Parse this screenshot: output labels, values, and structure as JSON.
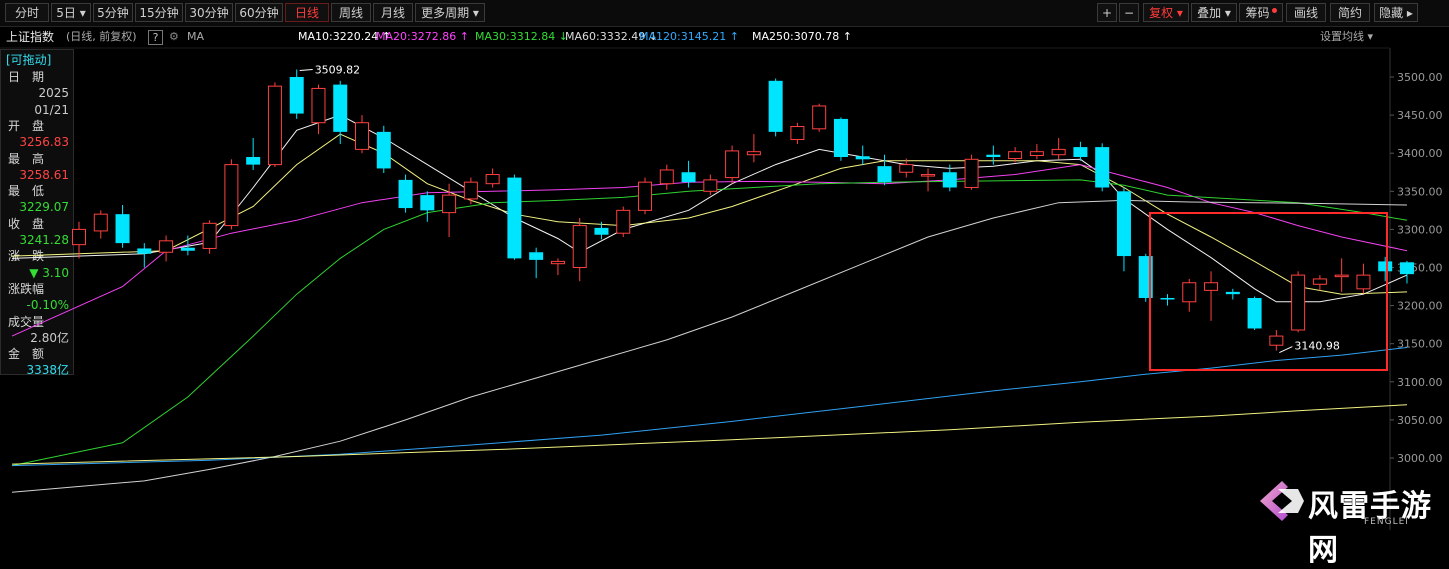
{
  "toolbar": {
    "periods": [
      {
        "label": "分时",
        "active": false
      },
      {
        "label": "5日 ▾",
        "active": false
      },
      {
        "label": "5分钟",
        "active": false
      },
      {
        "label": "15分钟",
        "active": false
      },
      {
        "label": "30分钟",
        "active": false
      },
      {
        "label": "60分钟",
        "active": false
      },
      {
        "label": "日线",
        "active": true
      },
      {
        "label": "周线",
        "active": false
      },
      {
        "label": "月线",
        "active": false
      },
      {
        "label": "更多周期 ▾",
        "active": false
      }
    ],
    "right_buttons": [
      "+",
      "−",
      "复权 ▾",
      "叠加 ▾",
      "筹码",
      "画线",
      "简约",
      "隐藏 ▸"
    ]
  },
  "header": {
    "index_name": "上证指数",
    "mode": "(日线, 前复权)",
    "help": "?",
    "ma_label": "MA",
    "ma_settings": "设置均线 ▾",
    "ma_items": [
      {
        "text": "MA10:3220.24 ↑",
        "color": "#ffffff"
      },
      {
        "text": "MA20:3272.86 ↑",
        "color": "#ff44ff"
      },
      {
        "text": "MA30:3312.84 ↓",
        "color": "#33dd33"
      },
      {
        "text": "MA60:3332.49 ↓",
        "color": "#dddddd"
      },
      {
        "text": "MA120:3145.21 ↑",
        "color": "#33aaff"
      },
      {
        "text": "MA250:3070.78 ↑",
        "color": "#ffffff"
      }
    ]
  },
  "info": {
    "drag": "[可拖动]",
    "rows": [
      {
        "label": "日　期",
        "value": "",
        "color": "#cccccc"
      },
      {
        "label": "",
        "value": "2025",
        "color": "#cccccc"
      },
      {
        "label": "",
        "value": "01/21",
        "color": "#cccccc"
      },
      {
        "label": "开　盘",
        "value": "",
        "color": "#cccccc"
      },
      {
        "label": "",
        "value": "3256.83",
        "color": "#ff4444"
      },
      {
        "label": "最　高",
        "value": "",
        "color": "#cccccc"
      },
      {
        "label": "",
        "value": "3258.61",
        "color": "#ff4444"
      },
      {
        "label": "最　低",
        "value": "",
        "color": "#cccccc"
      },
      {
        "label": "",
        "value": "3229.07",
        "color": "#33dd33"
      },
      {
        "label": "收　盘",
        "value": "",
        "color": "#cccccc"
      },
      {
        "label": "",
        "value": "3241.28",
        "color": "#33dd33"
      },
      {
        "label": "涨　跌",
        "value": "",
        "color": "#cccccc"
      },
      {
        "label": "",
        "value": "▼ 3.10",
        "color": "#33dd33"
      },
      {
        "label": "涨跌幅",
        "value": "",
        "color": "#cccccc"
      },
      {
        "label": "",
        "value": "-0.10%",
        "color": "#33dd33"
      },
      {
        "label": "成交量",
        "value": "",
        "color": "#cccccc"
      },
      {
        "label": "",
        "value": "2.80亿",
        "color": "#cccccc"
      },
      {
        "label": "金　额",
        "value": "",
        "color": "#cccccc"
      },
      {
        "label": "",
        "value": "3338亿",
        "color": "#33ddee"
      }
    ]
  },
  "logo": {
    "name": "风雷手游网",
    "sub": "FENGLEI"
  },
  "colors": {
    "up": "#ff4040",
    "down": "#00e5ff",
    "highlight": "#ff2a2a"
  },
  "chart_data": {
    "type": "candlestick",
    "ylim": [
      2980,
      3530
    ],
    "y_ticks": [
      3000.0,
      3050.0,
      3100.0,
      3150.0,
      3200.0,
      3250.0,
      3300.0,
      3350.0,
      3400.0,
      3450.0,
      3500.0
    ],
    "candles": [
      {
        "o": 3280,
        "c": 3300,
        "h": 3310,
        "l": 3262
      },
      {
        "o": 3298,
        "c": 3320,
        "h": 3325,
        "l": 3288
      },
      {
        "o": 3320,
        "c": 3282,
        "h": 3332,
        "l": 3276
      },
      {
        "o": 3275,
        "c": 3268,
        "h": 3282,
        "l": 3250
      },
      {
        "o": 3270,
        "c": 3285,
        "h": 3292,
        "l": 3258
      },
      {
        "o": 3276,
        "c": 3272,
        "h": 3292,
        "l": 3266
      },
      {
        "o": 3275,
        "c": 3308,
        "h": 3312,
        "l": 3268
      },
      {
        "o": 3305,
        "c": 3385,
        "h": 3392,
        "l": 3300
      },
      {
        "o": 3395,
        "c": 3385,
        "h": 3420,
        "l": 3378
      },
      {
        "o": 3385,
        "c": 3488,
        "h": 3493,
        "l": 3382
      },
      {
        "o": 3500,
        "c": 3452,
        "h": 3509.82,
        "l": 3445
      },
      {
        "o": 3440,
        "c": 3485,
        "h": 3490,
        "l": 3425
      },
      {
        "o": 3490,
        "c": 3428,
        "h": 3495,
        "l": 3412
      },
      {
        "o": 3405,
        "c": 3440,
        "h": 3450,
        "l": 3400
      },
      {
        "o": 3428,
        "c": 3380,
        "h": 3436,
        "l": 3374
      },
      {
        "o": 3365,
        "c": 3328,
        "h": 3372,
        "l": 3322
      },
      {
        "o": 3345,
        "c": 3325,
        "h": 3350,
        "l": 3310
      },
      {
        "o": 3322,
        "c": 3345,
        "h": 3360,
        "l": 3290
      },
      {
        "o": 3340,
        "c": 3362,
        "h": 3368,
        "l": 3333
      },
      {
        "o": 3360,
        "c": 3372,
        "h": 3380,
        "l": 3355
      },
      {
        "o": 3368,
        "c": 3262,
        "h": 3372,
        "l": 3260
      },
      {
        "o": 3270,
        "c": 3260,
        "h": 3276,
        "l": 3236
      },
      {
        "o": 3255,
        "c": 3258,
        "h": 3262,
        "l": 3240
      },
      {
        "o": 3250,
        "c": 3305,
        "h": 3315,
        "l": 3232
      },
      {
        "o": 3302,
        "c": 3293,
        "h": 3310,
        "l": 3287
      },
      {
        "o": 3295,
        "c": 3325,
        "h": 3330,
        "l": 3290
      },
      {
        "o": 3325,
        "c": 3362,
        "h": 3368,
        "l": 3320
      },
      {
        "o": 3360,
        "c": 3378,
        "h": 3385,
        "l": 3352
      },
      {
        "o": 3375,
        "c": 3362,
        "h": 3390,
        "l": 3355
      },
      {
        "o": 3350,
        "c": 3365,
        "h": 3372,
        "l": 3345
      },
      {
        "o": 3368,
        "c": 3403,
        "h": 3410,
        "l": 3360
      },
      {
        "o": 3398,
        "c": 3402,
        "h": 3425,
        "l": 3388
      },
      {
        "o": 3495,
        "c": 3428,
        "h": 3498,
        "l": 3422
      },
      {
        "o": 3418,
        "c": 3435,
        "h": 3440,
        "l": 3412
      },
      {
        "o": 3432,
        "c": 3462,
        "h": 3465,
        "l": 3428
      },
      {
        "o": 3445,
        "c": 3395,
        "h": 3447,
        "l": 3390
      },
      {
        "o": 3396,
        "c": 3392,
        "h": 3410,
        "l": 3385
      },
      {
        "o": 3383,
        "c": 3362,
        "h": 3398,
        "l": 3358
      },
      {
        "o": 3375,
        "c": 3385,
        "h": 3393,
        "l": 3368
      },
      {
        "o": 3370,
        "c": 3372,
        "h": 3380,
        "l": 3350
      },
      {
        "o": 3375,
        "c": 3355,
        "h": 3385,
        "l": 3350
      },
      {
        "o": 3355,
        "c": 3392,
        "h": 3398,
        "l": 3352
      },
      {
        "o": 3398,
        "c": 3395,
        "h": 3410,
        "l": 3385
      },
      {
        "o": 3393,
        "c": 3402,
        "h": 3408,
        "l": 3388
      },
      {
        "o": 3397,
        "c": 3402,
        "h": 3412,
        "l": 3392
      },
      {
        "o": 3398,
        "c": 3405,
        "h": 3420,
        "l": 3392
      },
      {
        "o": 3408,
        "c": 3395,
        "h": 3415,
        "l": 3390
      },
      {
        "o": 3408,
        "c": 3355,
        "h": 3413,
        "l": 3350
      },
      {
        "o": 3350,
        "c": 3265,
        "h": 3355,
        "l": 3245
      },
      {
        "o": 3265,
        "c": 3210,
        "h": 3268,
        "l": 3205
      },
      {
        "o": 3210,
        "c": 3208,
        "h": 3215,
        "l": 3200
      },
      {
        "o": 3205,
        "c": 3230,
        "h": 3235,
        "l": 3192
      },
      {
        "o": 3220,
        "c": 3230,
        "h": 3245,
        "l": 3180
      },
      {
        "o": 3218,
        "c": 3215,
        "h": 3222,
        "l": 3208
      },
      {
        "o": 3210,
        "c": 3170,
        "h": 3212,
        "l": 3168
      },
      {
        "o": 3148,
        "c": 3160,
        "h": 3168,
        "l": 3140.98
      },
      {
        "o": 3168,
        "c": 3240,
        "h": 3245,
        "l": 3165
      },
      {
        "o": 3228,
        "c": 3235,
        "h": 3240,
        "l": 3220
      },
      {
        "o": 3238,
        "c": 3240,
        "h": 3262,
        "l": 3218
      },
      {
        "o": 3222,
        "c": 3240,
        "h": 3255,
        "l": 3216
      },
      {
        "o": 3258,
        "c": 3245,
        "h": 3264,
        "l": 3232
      },
      {
        "o": 3256.83,
        "c": 3241.28,
        "h": 3258.61,
        "l": 3229.07
      }
    ],
    "annotations": [
      {
        "text": "3509.82",
        "index": 10,
        "value": 3509.82
      },
      {
        "text": "3140.98",
        "index": 55,
        "value": 3140.98
      }
    ],
    "series": [
      {
        "name": "MA10",
        "color": "#ffffff",
        "points": [
          [
            0,
            3262
          ],
          [
            3,
            3268
          ],
          [
            6,
            3283
          ],
          [
            8,
            3355
          ],
          [
            10,
            3430
          ],
          [
            12,
            3450
          ],
          [
            14,
            3420
          ],
          [
            16,
            3385
          ],
          [
            18,
            3350
          ],
          [
            20,
            3315
          ],
          [
            22,
            3288
          ],
          [
            23,
            3270
          ],
          [
            25,
            3300
          ],
          [
            28,
            3325
          ],
          [
            30,
            3360
          ],
          [
            32,
            3385
          ],
          [
            34,
            3405
          ],
          [
            36,
            3395
          ],
          [
            38,
            3385
          ],
          [
            40,
            3380
          ],
          [
            42,
            3383
          ],
          [
            44,
            3390
          ],
          [
            46,
            3392
          ],
          [
            47,
            3372
          ],
          [
            48,
            3340
          ],
          [
            50,
            3300
          ],
          [
            52,
            3263
          ],
          [
            54,
            3222
          ],
          [
            55,
            3205
          ],
          [
            57,
            3205
          ],
          [
            59,
            3215
          ],
          [
            61,
            3240
          ]
        ]
      },
      {
        "name": "MA20",
        "color": "#ffff88",
        "points": [
          [
            0,
            3265
          ],
          [
            4,
            3272
          ],
          [
            8,
            3330
          ],
          [
            10,
            3385
          ],
          [
            12,
            3425
          ],
          [
            14,
            3400
          ],
          [
            16,
            3360
          ],
          [
            18,
            3338
          ],
          [
            20,
            3320
          ],
          [
            22,
            3310
          ],
          [
            25,
            3305
          ],
          [
            28,
            3315
          ],
          [
            30,
            3330
          ],
          [
            33,
            3360
          ],
          [
            35,
            3380
          ],
          [
            37,
            3390
          ],
          [
            40,
            3390
          ],
          [
            44,
            3390
          ],
          [
            46,
            3385
          ],
          [
            48,
            3355
          ],
          [
            50,
            3320
          ],
          [
            52,
            3290
          ],
          [
            54,
            3258
          ],
          [
            56,
            3225
          ],
          [
            58,
            3215
          ],
          [
            61,
            3218
          ]
        ]
      },
      {
        "name": "MA30",
        "color": "#ff44ff",
        "points": [
          [
            0,
            3160
          ],
          [
            2,
            3225
          ],
          [
            4,
            3272
          ],
          [
            7,
            3295
          ],
          [
            10,
            3312
          ],
          [
            13,
            3335
          ],
          [
            16,
            3348
          ],
          [
            19,
            3350
          ],
          [
            22,
            3352
          ],
          [
            25,
            3355
          ],
          [
            28,
            3362
          ],
          [
            31,
            3363
          ],
          [
            34,
            3362
          ],
          [
            37,
            3360
          ],
          [
            40,
            3365
          ],
          [
            43,
            3372
          ],
          [
            46,
            3385
          ],
          [
            48,
            3370
          ],
          [
            50,
            3355
          ],
          [
            52,
            3335
          ],
          [
            54,
            3322
          ],
          [
            56,
            3305
          ],
          [
            58,
            3290
          ],
          [
            61,
            3272
          ]
        ]
      },
      {
        "name": "MA60",
        "color": "#33dd33",
        "points": [
          [
            0,
            2990
          ],
          [
            2,
            3020
          ],
          [
            5,
            3080
          ],
          [
            8,
            3160
          ],
          [
            10,
            3215
          ],
          [
            12,
            3262
          ],
          [
            14,
            3300
          ],
          [
            16,
            3322
          ],
          [
            19,
            3335
          ],
          [
            22,
            3338
          ],
          [
            25,
            3342
          ],
          [
            28,
            3350
          ],
          [
            31,
            3355
          ],
          [
            34,
            3360
          ],
          [
            37,
            3362
          ],
          [
            40,
            3363
          ],
          [
            43,
            3364
          ],
          [
            46,
            3365
          ],
          [
            48,
            3358
          ],
          [
            50,
            3345
          ],
          [
            53,
            3340
          ],
          [
            56,
            3335
          ],
          [
            59,
            3322
          ],
          [
            61,
            3312
          ]
        ]
      },
      {
        "name": "MA120",
        "color": "#dddddd",
        "points": [
          [
            0,
            2955
          ],
          [
            3,
            2970
          ],
          [
            6,
            2985
          ],
          [
            9,
            3002
          ],
          [
            12,
            3022
          ],
          [
            15,
            3050
          ],
          [
            18,
            3080
          ],
          [
            21,
            3105
          ],
          [
            24,
            3130
          ],
          [
            27,
            3155
          ],
          [
            30,
            3185
          ],
          [
            33,
            3220
          ],
          [
            36,
            3255
          ],
          [
            39,
            3290
          ],
          [
            42,
            3315
          ],
          [
            45,
            3335
          ],
          [
            48,
            3338
          ],
          [
            51,
            3336
          ],
          [
            54,
            3335
          ],
          [
            57,
            3334
          ],
          [
            61,
            3332
          ]
        ]
      },
      {
        "name": "MA250",
        "color": "#33aaff",
        "points": [
          [
            0,
            2990
          ],
          [
            6,
            2997
          ],
          [
            12,
            3005
          ],
          [
            18,
            3017
          ],
          [
            24,
            3030
          ],
          [
            30,
            3048
          ],
          [
            36,
            3068
          ],
          [
            42,
            3088
          ],
          [
            46,
            3100
          ],
          [
            49,
            3110
          ],
          [
            52,
            3118
          ],
          [
            55,
            3128
          ],
          [
            58,
            3135
          ],
          [
            61,
            3145
          ]
        ]
      },
      {
        "name": "MA250b",
        "color": "#ffff88",
        "points": [
          [
            0,
            2992
          ],
          [
            10,
            3002
          ],
          [
            20,
            3012
          ],
          [
            30,
            3024
          ],
          [
            40,
            3037
          ],
          [
            46,
            3047
          ],
          [
            52,
            3055
          ],
          [
            56,
            3062
          ],
          [
            61,
            3070
          ]
        ]
      }
    ]
  }
}
